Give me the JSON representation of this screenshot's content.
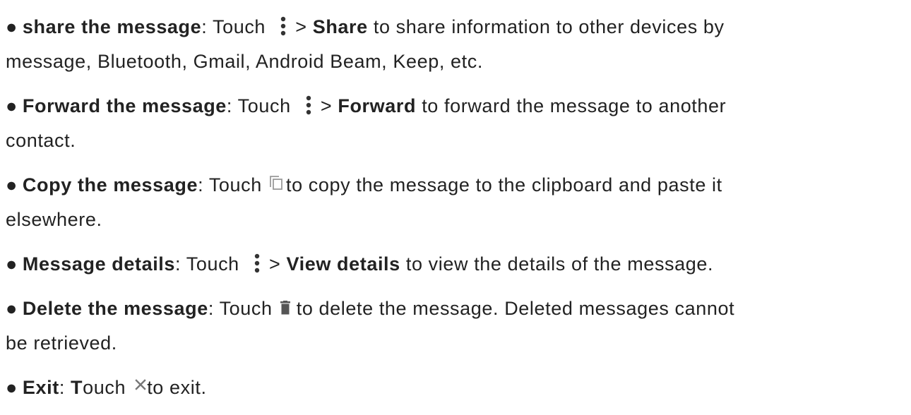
{
  "items": [
    {
      "title": "share the message",
      "pre": ": Touch ",
      "icon": "more-vert-icon",
      "gt": " > ",
      "action": "Share",
      "post1": " to share information to other devices by",
      "post2": "message, Bluetooth, Gmail, Android Beam, Keep, etc."
    },
    {
      "title": "Forward the message",
      "pre": ": Touch ",
      "icon": "more-vert-icon",
      "gt": " > ",
      "action": "Forward",
      "post1": " to forward the message to another",
      "post2": "contact."
    },
    {
      "title": "Copy the message",
      "pre": ": Touch ",
      "icon": "copy-icon",
      "post1": "to copy the message to the clipboard and paste it",
      "post2": "elsewhere."
    },
    {
      "title": "Message details",
      "pre": ": Touch ",
      "icon": "more-vert-icon",
      "gt": " > ",
      "action": "View details",
      "post1": " to view the details of the message."
    },
    {
      "title": "Delete the message",
      "pre": ": Touch ",
      "icon": "delete-icon",
      "post1": "to delete the message. Deleted messages cannot",
      "post2": "be retrieved."
    },
    {
      "title_bold": "Exit",
      "pre": ": ",
      "pre_bold": "T",
      "pre_rest": "ouch ",
      "icon": "close-icon",
      "post1": "to exit."
    }
  ],
  "bullet": "●",
  "colors": {
    "text": "#222222",
    "icon": "#333333",
    "icon_light": "#9a9a9a"
  }
}
